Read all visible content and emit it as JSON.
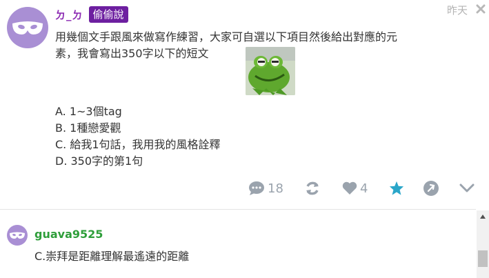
{
  "post": {
    "author_name": "ㄉ_ㄉ",
    "author_badge": "偷偷說",
    "timestamp": "昨天",
    "body_lines": [
      "用幾個文手跟風來做寫作練習，大家可自選以下項目然後給出對應的元",
      "素，我會寫出350字以下的短文"
    ],
    "options": [
      "A. 1~3個tag",
      "B. 1種戀愛觀",
      "C. 給我1句話，我用我的風格詮釋",
      "D. 350字的第1句"
    ]
  },
  "actions": {
    "comment_count": "18",
    "like_count": "4"
  },
  "comment": {
    "author": "guava9525",
    "text": "C.崇拜是距離理解最遙遠的距離"
  },
  "colors": {
    "avatar": "#a98fd4",
    "author_name": "#8c2bb3",
    "badge": "#6d1fa0",
    "commenter": "#2e9e3a",
    "star": "#2aa6c9",
    "icon": "#9aa3ad"
  }
}
